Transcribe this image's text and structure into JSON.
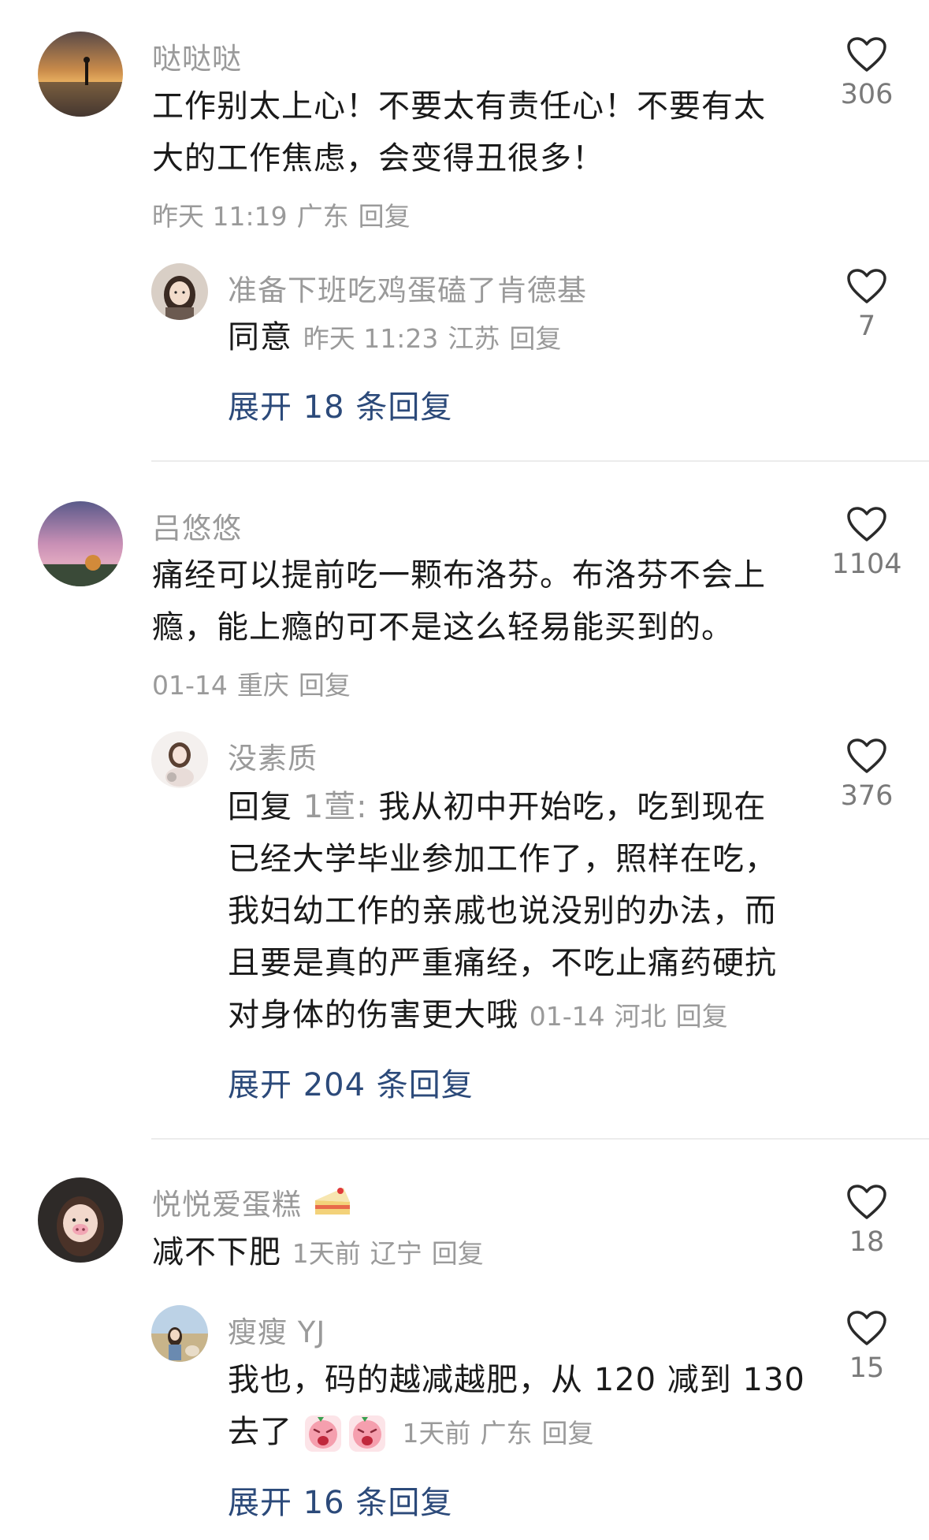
{
  "comments": [
    {
      "username": "哒哒哒",
      "lines": [
        "工作别太上心！不要太有责任心！不要有太",
        "大的工作焦虑，会变得丑很多！"
      ],
      "time": "昨天 11:19",
      "location": "广东",
      "reply_label": "回复",
      "likes": "306",
      "reply": {
        "username": "准备下班吃鸡蛋磕了肯德基",
        "text": "同意",
        "time": "昨天 11:23",
        "location": "江苏",
        "reply_label": "回复",
        "likes": "7"
      },
      "expand_label": "展开 18 条回复"
    },
    {
      "username": "吕悠悠",
      "lines": [
        "痛经可以提前吃一颗布洛芬。布洛芬不会上",
        "瘾，能上瘾的可不是这么轻易能买到的。"
      ],
      "time": "01-14",
      "location": "重庆",
      "reply_label": "回复",
      "likes": "1104",
      "reply": {
        "username": "没素质",
        "prefix": "回复",
        "mention": "1萱:",
        "line1": "我从初中开始吃，吃到现在",
        "lines": [
          "已经大学毕业参加工作了，照样在吃，",
          "我妇幼工作的亲戚也说没别的办法，而",
          "且要是真的严重痛经，不吃止痛药硬抗"
        ],
        "last_line": "对身体的伤害更大哦",
        "time": "01-14",
        "location": "河北",
        "reply_label": "回复",
        "likes": "376"
      },
      "expand_label": "展开 204 条回复"
    },
    {
      "username": "悦悦爱蛋糕",
      "username_emoji": "cake-icon",
      "text": "减不下肥",
      "time": "1天前",
      "location": "辽宁",
      "reply_label": "回复",
      "likes": "18",
      "reply": {
        "username": "瘦瘦 YJ",
        "line1": "我也，码的越减越肥，从 120 减到 130",
        "line2": "去了",
        "emoji": "crying-face-icon",
        "time": "1天前",
        "location": "广东",
        "reply_label": "回复",
        "likes": "15"
      },
      "expand_label": "展开 16 条回复"
    }
  ],
  "colors": {
    "text": "#1a1a1a",
    "meta": "#9a9a9a",
    "link": "#2c4a7a",
    "divider": "#ececec"
  }
}
